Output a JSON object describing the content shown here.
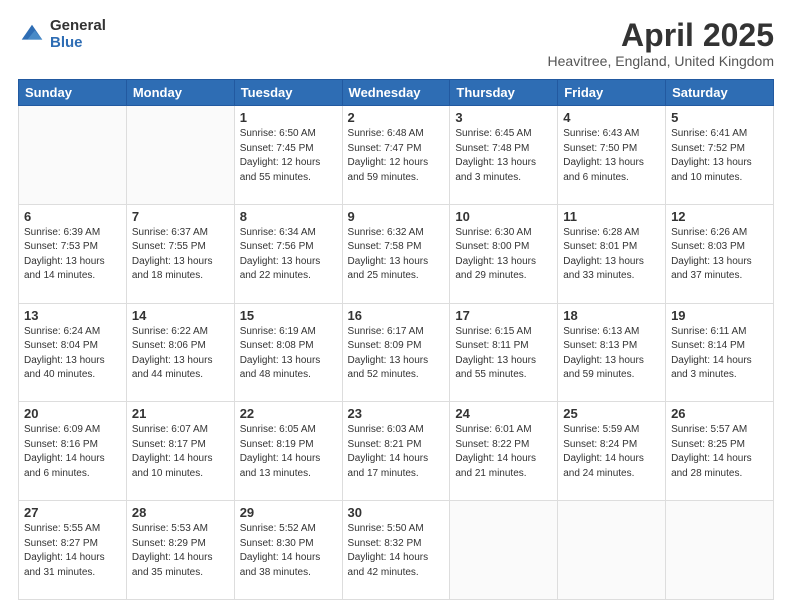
{
  "logo": {
    "general": "General",
    "blue": "Blue"
  },
  "title": {
    "month": "April 2025",
    "location": "Heavitree, England, United Kingdom"
  },
  "weekdays": [
    "Sunday",
    "Monday",
    "Tuesday",
    "Wednesday",
    "Thursday",
    "Friday",
    "Saturday"
  ],
  "weeks": [
    [
      {
        "day": "",
        "info": ""
      },
      {
        "day": "",
        "info": ""
      },
      {
        "day": "1",
        "info": "Sunrise: 6:50 AM\nSunset: 7:45 PM\nDaylight: 12 hours\nand 55 minutes."
      },
      {
        "day": "2",
        "info": "Sunrise: 6:48 AM\nSunset: 7:47 PM\nDaylight: 12 hours\nand 59 minutes."
      },
      {
        "day": "3",
        "info": "Sunrise: 6:45 AM\nSunset: 7:48 PM\nDaylight: 13 hours\nand 3 minutes."
      },
      {
        "day": "4",
        "info": "Sunrise: 6:43 AM\nSunset: 7:50 PM\nDaylight: 13 hours\nand 6 minutes."
      },
      {
        "day": "5",
        "info": "Sunrise: 6:41 AM\nSunset: 7:52 PM\nDaylight: 13 hours\nand 10 minutes."
      }
    ],
    [
      {
        "day": "6",
        "info": "Sunrise: 6:39 AM\nSunset: 7:53 PM\nDaylight: 13 hours\nand 14 minutes."
      },
      {
        "day": "7",
        "info": "Sunrise: 6:37 AM\nSunset: 7:55 PM\nDaylight: 13 hours\nand 18 minutes."
      },
      {
        "day": "8",
        "info": "Sunrise: 6:34 AM\nSunset: 7:56 PM\nDaylight: 13 hours\nand 22 minutes."
      },
      {
        "day": "9",
        "info": "Sunrise: 6:32 AM\nSunset: 7:58 PM\nDaylight: 13 hours\nand 25 minutes."
      },
      {
        "day": "10",
        "info": "Sunrise: 6:30 AM\nSunset: 8:00 PM\nDaylight: 13 hours\nand 29 minutes."
      },
      {
        "day": "11",
        "info": "Sunrise: 6:28 AM\nSunset: 8:01 PM\nDaylight: 13 hours\nand 33 minutes."
      },
      {
        "day": "12",
        "info": "Sunrise: 6:26 AM\nSunset: 8:03 PM\nDaylight: 13 hours\nand 37 minutes."
      }
    ],
    [
      {
        "day": "13",
        "info": "Sunrise: 6:24 AM\nSunset: 8:04 PM\nDaylight: 13 hours\nand 40 minutes."
      },
      {
        "day": "14",
        "info": "Sunrise: 6:22 AM\nSunset: 8:06 PM\nDaylight: 13 hours\nand 44 minutes."
      },
      {
        "day": "15",
        "info": "Sunrise: 6:19 AM\nSunset: 8:08 PM\nDaylight: 13 hours\nand 48 minutes."
      },
      {
        "day": "16",
        "info": "Sunrise: 6:17 AM\nSunset: 8:09 PM\nDaylight: 13 hours\nand 52 minutes."
      },
      {
        "day": "17",
        "info": "Sunrise: 6:15 AM\nSunset: 8:11 PM\nDaylight: 13 hours\nand 55 minutes."
      },
      {
        "day": "18",
        "info": "Sunrise: 6:13 AM\nSunset: 8:13 PM\nDaylight: 13 hours\nand 59 minutes."
      },
      {
        "day": "19",
        "info": "Sunrise: 6:11 AM\nSunset: 8:14 PM\nDaylight: 14 hours\nand 3 minutes."
      }
    ],
    [
      {
        "day": "20",
        "info": "Sunrise: 6:09 AM\nSunset: 8:16 PM\nDaylight: 14 hours\nand 6 minutes."
      },
      {
        "day": "21",
        "info": "Sunrise: 6:07 AM\nSunset: 8:17 PM\nDaylight: 14 hours\nand 10 minutes."
      },
      {
        "day": "22",
        "info": "Sunrise: 6:05 AM\nSunset: 8:19 PM\nDaylight: 14 hours\nand 13 minutes."
      },
      {
        "day": "23",
        "info": "Sunrise: 6:03 AM\nSunset: 8:21 PM\nDaylight: 14 hours\nand 17 minutes."
      },
      {
        "day": "24",
        "info": "Sunrise: 6:01 AM\nSunset: 8:22 PM\nDaylight: 14 hours\nand 21 minutes."
      },
      {
        "day": "25",
        "info": "Sunrise: 5:59 AM\nSunset: 8:24 PM\nDaylight: 14 hours\nand 24 minutes."
      },
      {
        "day": "26",
        "info": "Sunrise: 5:57 AM\nSunset: 8:25 PM\nDaylight: 14 hours\nand 28 minutes."
      }
    ],
    [
      {
        "day": "27",
        "info": "Sunrise: 5:55 AM\nSunset: 8:27 PM\nDaylight: 14 hours\nand 31 minutes."
      },
      {
        "day": "28",
        "info": "Sunrise: 5:53 AM\nSunset: 8:29 PM\nDaylight: 14 hours\nand 35 minutes."
      },
      {
        "day": "29",
        "info": "Sunrise: 5:52 AM\nSunset: 8:30 PM\nDaylight: 14 hours\nand 38 minutes."
      },
      {
        "day": "30",
        "info": "Sunrise: 5:50 AM\nSunset: 8:32 PM\nDaylight: 14 hours\nand 42 minutes."
      },
      {
        "day": "",
        "info": ""
      },
      {
        "day": "",
        "info": ""
      },
      {
        "day": "",
        "info": ""
      }
    ]
  ]
}
